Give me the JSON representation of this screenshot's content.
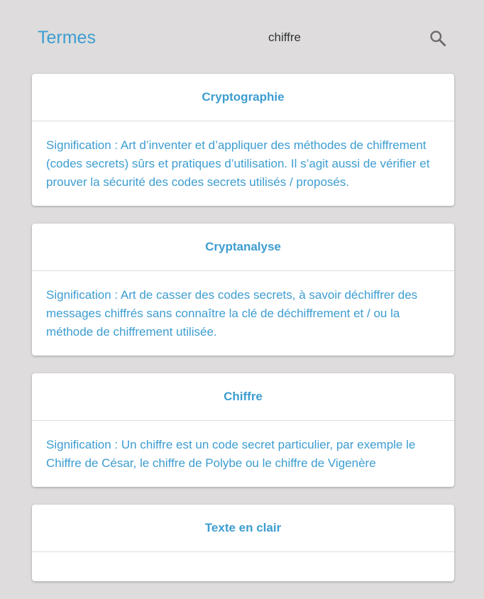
{
  "header": {
    "title": "Termes",
    "search_query": "chiffre",
    "search_icon": "search-icon"
  },
  "colors": {
    "accent": "#3d9dd0",
    "background": "#dedcdc",
    "card": "#ffffff"
  },
  "terms": [
    {
      "title": "Cryptographie",
      "meaning": "Signification : Art d’inventer et d’appliquer des méthodes de chiffrement (codes secrets) sûrs et pratiques d’utilisation. Il s’agit aussi de vérifier et prouver la sécurité des codes secrets utilisés / proposés."
    },
    {
      "title": "Cryptanalyse",
      "meaning": "Signification : Art de casser des codes secrets, à savoir déchiffrer des messages chiffrés sans connaître la clé de déchiffrement et / ou la méthode de chiffrement utilisée."
    },
    {
      "title": "Chiffre",
      "meaning": "Signification : Un chiffre est un code secret particulier, par exemple le Chiffre de César, le chiffre de Polybe ou le chiffre de Vigenère"
    },
    {
      "title": "Texte en clair",
      "meaning": ""
    }
  ]
}
